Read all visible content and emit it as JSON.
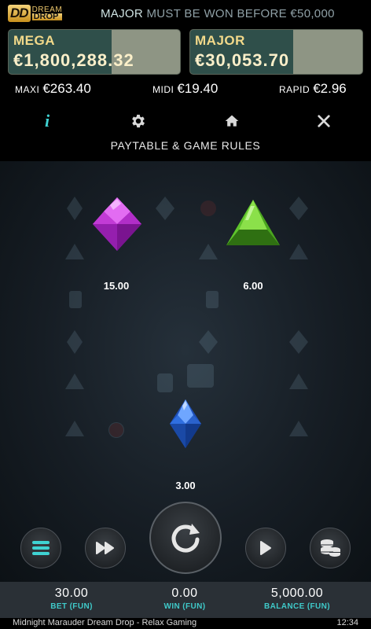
{
  "header": {
    "logo": {
      "mark": "DD",
      "line1": "DREAM",
      "line2": "DROP"
    },
    "ticker": {
      "highlight": "MAJOR",
      "rest": "MUST BE WON BEFORE €50,000"
    },
    "jackpots": [
      {
        "name": "MEGA",
        "amount": "€1,800,288.32",
        "fill_fraction": 0.6
      },
      {
        "name": "MAJOR",
        "amount": "€30,053.70",
        "fill_fraction": 0.6
      }
    ],
    "mini_jackpots": [
      {
        "label": "MAXI",
        "amount": "€263.40"
      },
      {
        "label": "MIDI",
        "amount": "€19.40"
      },
      {
        "label": "RAPID",
        "amount": "€2.96"
      }
    ]
  },
  "toolbar": {
    "info_glyph": "i",
    "icons": [
      "info-icon",
      "gear-icon",
      "home-icon",
      "close-icon"
    ],
    "title": "PAYTABLE & GAME RULES"
  },
  "paytable": {
    "symbols": [
      {
        "gem": "purple-gem",
        "color": "#c23bd6",
        "payout": "15.00"
      },
      {
        "gem": "green-gem",
        "color": "#5fc42c",
        "payout": "6.00"
      },
      {
        "gem": "blue-gem",
        "color": "#2f6fe0",
        "payout": "3.00"
      }
    ]
  },
  "controls": [
    "menu-button",
    "fast-forward-button",
    "spin-button",
    "autoplay-button",
    "bet-coins-button"
  ],
  "footer": {
    "bet": {
      "value": "30.00",
      "label": "BET (FUN)"
    },
    "win": {
      "value": "0.00",
      "label": "WIN (FUN)"
    },
    "balance": {
      "value": "5,000.00",
      "label": "BALANCE (FUN)"
    }
  },
  "statusbar": {
    "title": "Midnight Marauder Dream Drop - Relax Gaming",
    "clock": "12:34"
  },
  "colors": {
    "accent": "#3fd2d2",
    "jackpot_text": "#f2d98a",
    "footer_bg": "#2a3036"
  }
}
